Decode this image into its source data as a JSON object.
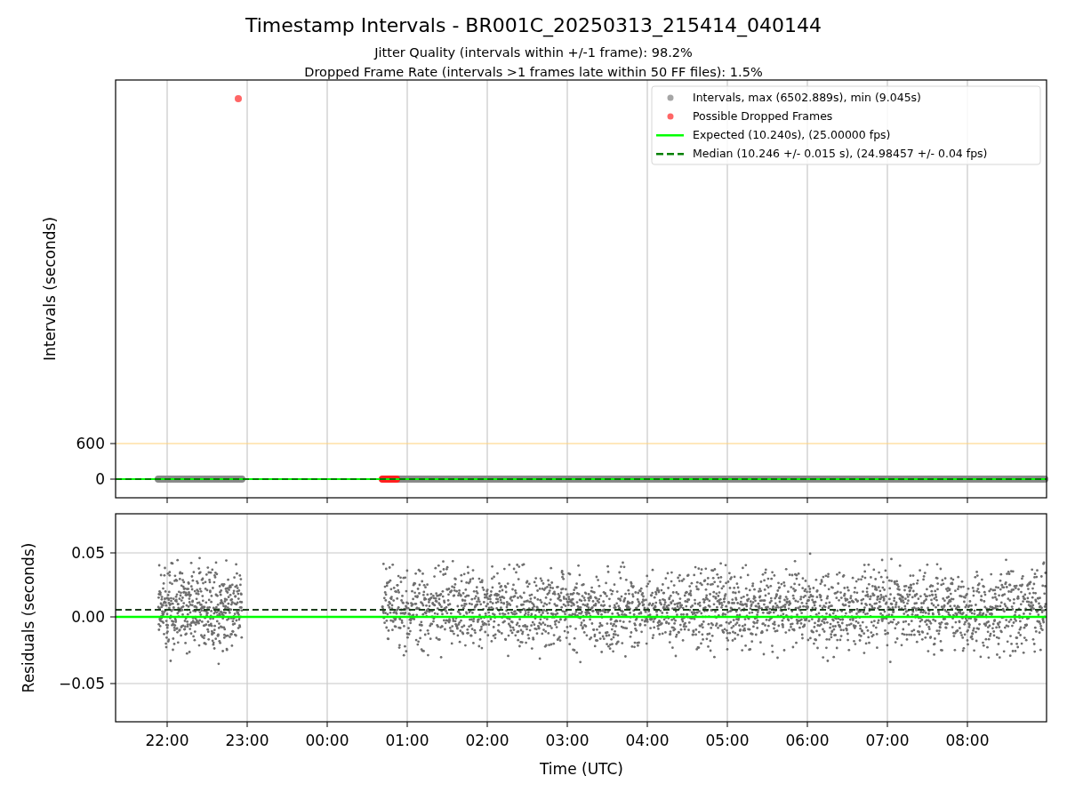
{
  "figure": {
    "title": "Timestamp Intervals - BR001C_20250313_215414_040144",
    "subtitles": [
      "Jitter Quality (intervals within +/-1 frame): 98.2%",
      "Dropped Frame Rate (intervals >1 frames late within 50 FF files): 1.5%"
    ]
  },
  "top_panel": {
    "ylabel": "Intervals (seconds)",
    "yticks": [
      "600",
      "0"
    ],
    "legend": [
      {
        "label": "Intervals, max (6502.889s), min (9.045s)",
        "kind": "marker",
        "color": "#a6a6a6"
      },
      {
        "label": "Possible Dropped Frames",
        "kind": "marker",
        "color": "#ff6666"
      },
      {
        "label": "Expected (10.240s), (25.00000 fps)",
        "kind": "line",
        "color": "#00ff00"
      },
      {
        "label": "Median (10.246 +/- 0.015 s), (24.98457 +/- 0.04 fps)",
        "kind": "dashed",
        "color": "#008000"
      }
    ]
  },
  "bottom_panel": {
    "ylabel": "Residuals (seconds)",
    "yticks": [
      "0.05",
      "0.00",
      "−0.05"
    ]
  },
  "x_axis": {
    "label": "Time (UTC)",
    "ticks": [
      "22:00",
      "23:00",
      "00:00",
      "01:00",
      "02:00",
      "03:00",
      "04:00",
      "05:00",
      "06:00",
      "07:00",
      "08:00"
    ]
  }
}
